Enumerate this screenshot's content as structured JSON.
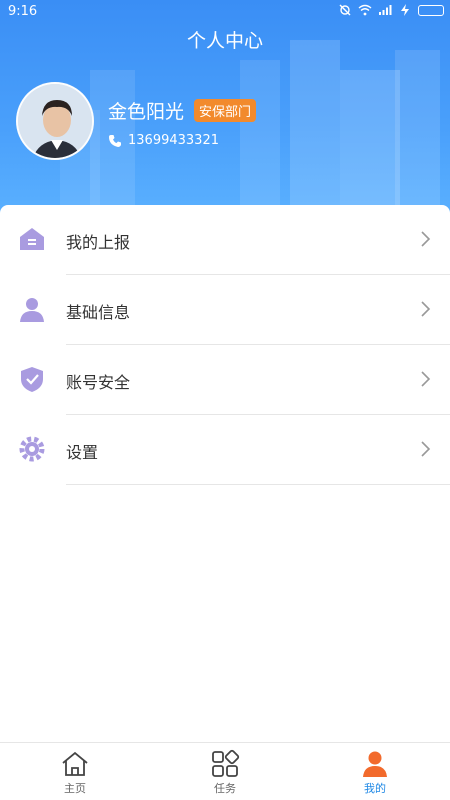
{
  "status_bar": {
    "time": "9:16"
  },
  "header": {
    "title": "个人中心",
    "user_name": "金色阳光",
    "department": "安保部门",
    "phone": "13699433321"
  },
  "menu": {
    "items": [
      {
        "label": "我的上报",
        "icon": "house-report-icon"
      },
      {
        "label": "基础信息",
        "icon": "user-profile-icon"
      },
      {
        "label": "账号安全",
        "icon": "shield-check-icon"
      },
      {
        "label": "设置",
        "icon": "gear-icon"
      }
    ]
  },
  "tabs": [
    {
      "label": "主页",
      "icon": "home-icon",
      "active": false
    },
    {
      "label": "任务",
      "icon": "grid-icon",
      "active": false
    },
    {
      "label": "我的",
      "icon": "person-icon",
      "active": true
    }
  ],
  "colors": {
    "header_blue": "#3a8ef5",
    "badge_orange": "#f28a2c",
    "icon_purple": "#a99be0",
    "active_tab_orange": "#f26a2c",
    "active_tab_text": "#1e88e5"
  }
}
